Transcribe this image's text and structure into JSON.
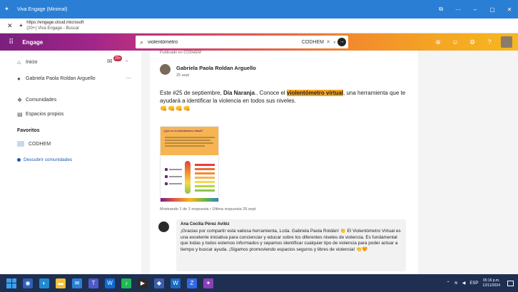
{
  "window": {
    "title": "Viva Engage (Minimal)",
    "controls": {
      "restore": "⧉",
      "more": "⋯",
      "minimize": "–",
      "maximize": "▢",
      "close": "✕"
    }
  },
  "address": {
    "close": "✕",
    "url": "https://engage.cloud.microsoft",
    "subtitle": "(20+) Viva Engage - Buscar"
  },
  "header": {
    "brand": "Engage",
    "search_value": "violentómetro",
    "search_scope": "CODHEM",
    "scope_clear": "✕",
    "scope_chevron": "∨",
    "search_go": "→"
  },
  "sidebar": {
    "home_label": "Inicio",
    "notif_count": "20+",
    "profile_label": "Gabriela Paola Roldan Arguello",
    "more": "···",
    "communities_label": "Comunidades",
    "storylines_label": "Espacios propios",
    "favorites_heading": "Favoritos",
    "favorite_community": "CODHEM",
    "discover_label": "Descubrir comunidades"
  },
  "post": {
    "published_in": "Publicado en CODHEM",
    "author": "Gabriela Paola Roldan Arguello",
    "date": "25 sept",
    "text_pre": "Este #25 de septiembre, ",
    "text_bold": "Día Naranja",
    "text_mid": ".. Conoce el ",
    "text_highlight": "violentómetro virtual",
    "text_post": ", una herramienta que te ayudará a identificar la violencia en todos sus niveles.",
    "emojis": "👊👊👊👊",
    "infographic_title": "¿Qué es el violentómetro virtual?",
    "replies_meta": "Mostrando 1 de 1 respuesta  •  Última respuesta 26 sept"
  },
  "comment": {
    "author": "Ana Cecilia Pérez Aviléz",
    "text": "¡Gracias por compartir esta valiosa herramienta, Lcda. Gabriela Paola Roldán! 👏 El Violentómetro Virtual es una excelente iniciativa para concienciar y educar sobre los diferentes niveles de violencia. Es fundamental que todas y todos estemos informados y sepamos identificar cualquier tipo de violencia para poder actuar a tiempo y buscar ayuda. ¡Sigamos promoviendo espacios seguros y libres de violencia! 👏🧡"
  },
  "taskbar": {
    "time": "05:16 p.m.",
    "date": "12/11/2024",
    "lang": "ESP"
  },
  "colors": {
    "accent_blue": "#2a7fd4",
    "highlight": "#f6a623",
    "taskbar": "#1e2f52",
    "badge": "#c4314b"
  }
}
